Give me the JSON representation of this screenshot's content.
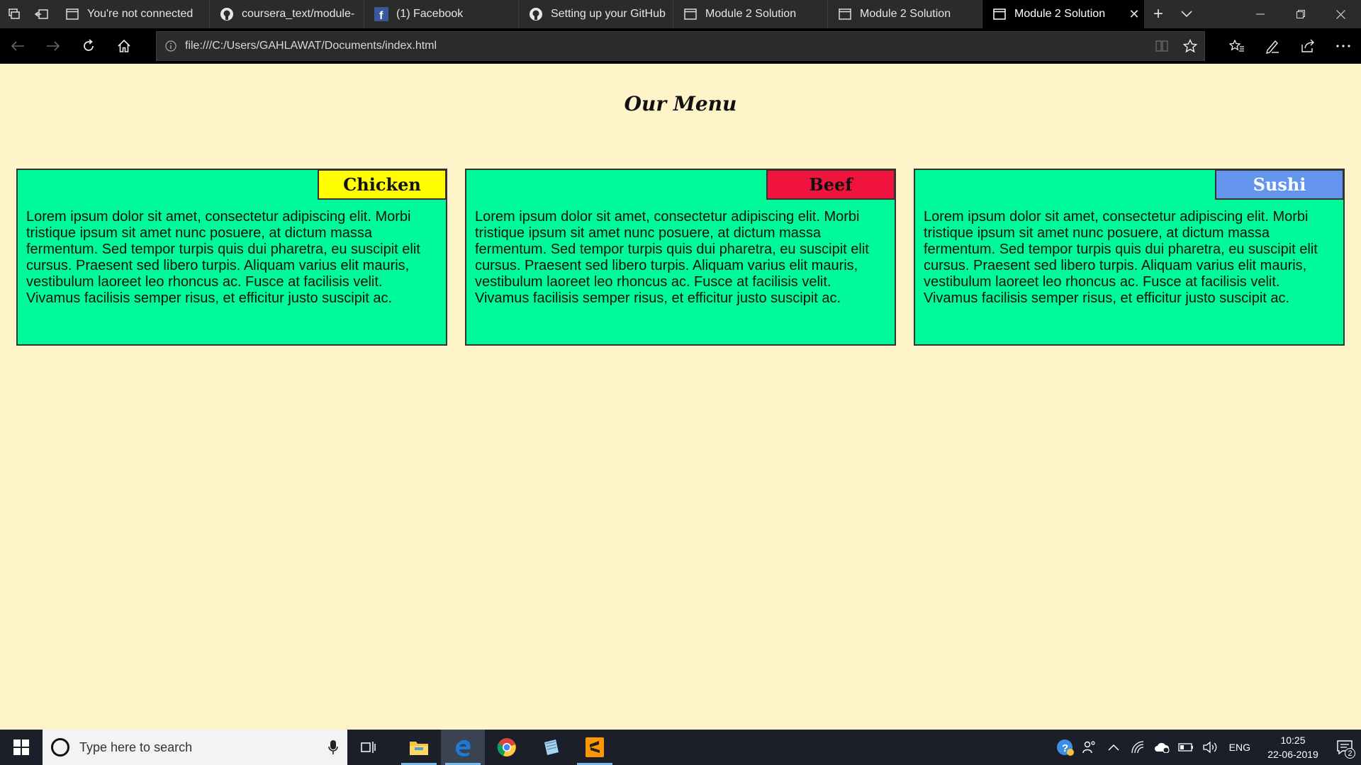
{
  "browser": {
    "tabs": [
      {
        "title": "You're not connected",
        "icon": "page-icon",
        "active": false
      },
      {
        "title": "coursera_text/module-",
        "icon": "github-icon",
        "active": false
      },
      {
        "title": "(1) Facebook",
        "icon": "facebook-icon",
        "active": false
      },
      {
        "title": "Setting up your GitHub",
        "icon": "github-icon",
        "active": false
      },
      {
        "title": "Module 2 Solution",
        "icon": "page-icon",
        "active": false
      },
      {
        "title": "Module 2 Solution",
        "icon": "page-icon",
        "active": false
      },
      {
        "title": "Module 2 Solution",
        "icon": "page-icon",
        "active": true
      }
    ],
    "tab_close_glyph": "✕",
    "new_tab_glyph": "+",
    "address": {
      "url": "file:///C:/Users/GAHLAWAT/Documents/index.html"
    }
  },
  "page": {
    "title": "Our Menu",
    "cards": [
      {
        "label": "Chicken",
        "badge_color": "#ffff00",
        "badge_text_color": "#111111",
        "text": "Lorem ipsum dolor sit amet, consectetur adipiscing elit. Morbi tristique ipsum sit amet nunc posuere, at dictum massa fermentum. Sed tempor turpis quis dui pharetra, eu suscipit elit cursus. Praesent sed libero turpis. Aliquam varius elit mauris, vestibulum laoreet leo rhoncus ac. Fusce at facilisis velit. Vivamus facilisis semper risus, et efficitur justo suscipit ac."
      },
      {
        "label": "Beef",
        "badge_color": "#f0133e",
        "badge_text_color": "#111111",
        "text": "Lorem ipsum dolor sit amet, consectetur adipiscing elit. Morbi tristique ipsum sit amet nunc posuere, at dictum massa fermentum. Sed tempor turpis quis dui pharetra, eu suscipit elit cursus. Praesent sed libero turpis. Aliquam varius elit mauris, vestibulum laoreet leo rhoncus ac. Fusce at facilisis velit. Vivamus facilisis semper risus, et efficitur justo suscipit ac."
      },
      {
        "label": "Sushi",
        "badge_color": "#6495ed",
        "badge_text_color": "#ffffff",
        "text": "Lorem ipsum dolor sit amet, consectetur adipiscing elit. Morbi tristique ipsum sit amet nunc posuere, at dictum massa fermentum. Sed tempor turpis quis dui pharetra, eu suscipit elit cursus. Praesent sed libero turpis. Aliquam varius elit mauris, vestibulum laoreet leo rhoncus ac. Fusce at facilisis velit. Vivamus facilisis semper risus, et efficitur justo suscipit ac."
      }
    ],
    "colors": {
      "background": "#fff4c9",
      "card": "#00fa9a"
    }
  },
  "taskbar": {
    "search_placeholder": "Type here to search",
    "apps": [
      "file-explorer-icon",
      "edge-icon",
      "chrome-icon",
      "notepad-icon",
      "sublime-text-icon"
    ],
    "language": "ENG",
    "time": "10:25",
    "date": "22-06-2019",
    "notification_count": "2"
  }
}
